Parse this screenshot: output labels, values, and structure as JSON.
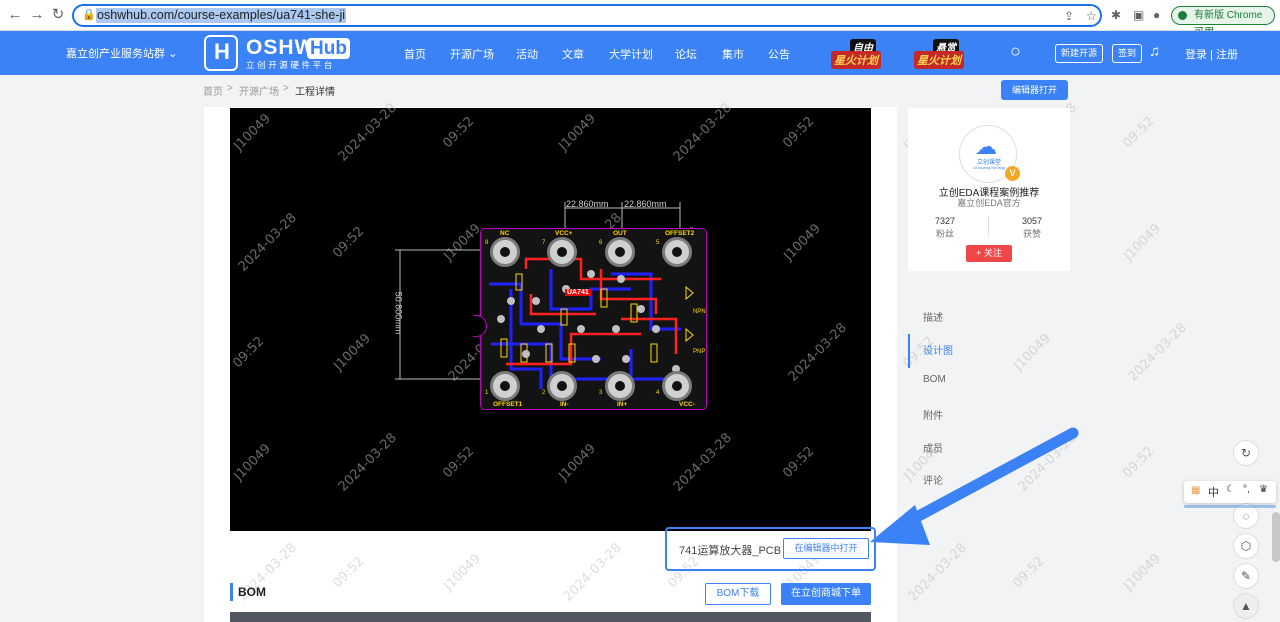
{
  "browser": {
    "url": "oshwhub.com/course-examples/ua741-she-ji",
    "update_label": "有新版 Chrome 可用"
  },
  "header": {
    "site_group": "嘉立创产业服务站群",
    "logo_main": "OSHW",
    "logo_hub": "Hub",
    "logo_sub": "立创开源硬件平台",
    "nav": [
      "首页",
      "开源广场",
      "活动",
      "文章",
      "大学计划",
      "论坛",
      "集市",
      "公告"
    ],
    "promo1": {
      "top": "自由",
      "bottom": "星火计划"
    },
    "promo2": {
      "top": "悬赏",
      "bottom": "星火计划"
    },
    "new_project": "新建开源",
    "signin": "签到",
    "login": "登录 | 注册"
  },
  "breadcrumb": {
    "home": "首页",
    "sep": ">",
    "square": "开源广场",
    "current": "工程详情"
  },
  "edit_open": "编辑器打开",
  "pcb": {
    "dim_h1": "22.860mm",
    "dim_h2": "22.860mm",
    "dim_v": "50.800mm",
    "top_labels": [
      "NC",
      "VCC+",
      "OUT",
      "OFFSET2"
    ],
    "top_nums": [
      "8",
      "7",
      "6",
      "5"
    ],
    "bottom_labels": [
      "OFFSET1",
      "IN-",
      "IN+",
      "VCC-"
    ],
    "bottom_nums": [
      "1",
      "2",
      "3",
      "4"
    ],
    "chip": "UA741",
    "npn": "NPN",
    "pnp": "PNP",
    "watermark_user": "J10049",
    "watermark_date": "2024-03-28",
    "watermark_time": "09:52"
  },
  "caption": "741运算放大器_PCB",
  "open_in_editor": "在编辑器中打开",
  "bom": {
    "title": "BOM",
    "download": "BOM下载",
    "order": "在立创商城下单"
  },
  "profile": {
    "avatar_text": "立创课堂",
    "avatar_sub": "LiChuang KeTang",
    "badge": "V",
    "name": "立创EDA课程案例推荐",
    "subtitle": "嘉立创EDA官方",
    "fans_count": "7327",
    "fans_label": "粉丝",
    "likes_count": "3057",
    "likes_label": "获赞",
    "follow": "+ 关注"
  },
  "side_nav": [
    "描述",
    "设计图",
    "BOM",
    "附件",
    "成员",
    "评论"
  ],
  "ime": "中",
  "colors": {
    "brand": "#3b82f6",
    "danger": "#f04848",
    "pcb_bg": "#000000",
    "board_outline": "#c000c0"
  }
}
